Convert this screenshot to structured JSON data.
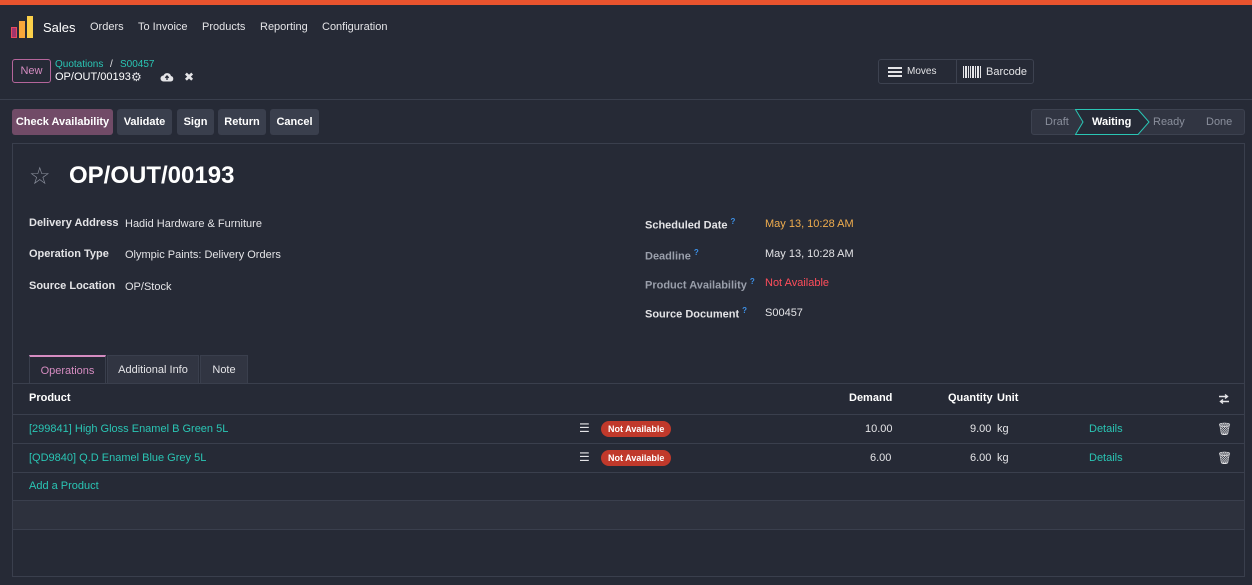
{
  "navbar": {
    "app_name": "Sales",
    "menu": [
      "Orders",
      "To Invoice",
      "Products",
      "Reporting",
      "Configuration"
    ]
  },
  "control": {
    "new_label": "New",
    "breadcrumb": {
      "parent": "Quotations",
      "separator": "/",
      "order": "S00457"
    },
    "record_name": "OP/OUT/00193",
    "smart_buttons": {
      "moves": "Moves",
      "barcode": "Barcode"
    }
  },
  "actions": {
    "check_availability": "Check Availability",
    "validate": "Validate",
    "sign": "Sign",
    "return": "Return",
    "cancel": "Cancel"
  },
  "stages": {
    "draft": "Draft",
    "waiting": "Waiting",
    "ready": "Ready",
    "done": "Done",
    "current": "Waiting"
  },
  "form": {
    "title": "OP/OUT/00193",
    "left": {
      "delivery_address_label": "Delivery Address",
      "delivery_address": "Hadid Hardware & Furniture",
      "operation_type_label": "Operation Type",
      "operation_type": "Olympic Paints: Delivery Orders",
      "source_location_label": "Source Location",
      "source_location": "OP/Stock"
    },
    "right": {
      "scheduled_date_label": "Scheduled Date",
      "scheduled_date": "May 13, 10:28 AM",
      "deadline_label": "Deadline",
      "deadline": "May 13, 10:28 AM",
      "availability_label": "Product Availability",
      "availability": "Not Available",
      "source_document_label": "Source Document",
      "source_document": "S00457"
    },
    "help_mark": "?"
  },
  "tabs": {
    "operations": "Operations",
    "additional_info": "Additional Info",
    "note": "Note"
  },
  "table": {
    "headers": {
      "product": "Product",
      "demand": "Demand",
      "quantity": "Quantity",
      "unit": "Unit"
    },
    "rows": [
      {
        "product": "[299841] High Gloss Enamel B Green 5L",
        "badge": "Not Available",
        "demand": "10.00",
        "quantity": "9.00",
        "unit": "kg",
        "details": "Details"
      },
      {
        "product": "[QD9840] Q.D Enamel Blue Grey 5L",
        "badge": "Not Available",
        "demand": "6.00",
        "quantity": "6.00",
        "unit": "kg",
        "details": "Details"
      }
    ],
    "add_product": "Add a Product"
  },
  "colors": {
    "accent": "#714b67",
    "link": "#2ac5b4",
    "danger": "#ff4d5b",
    "warning": "#f0ad4e",
    "top_bar": "#e8532e"
  }
}
